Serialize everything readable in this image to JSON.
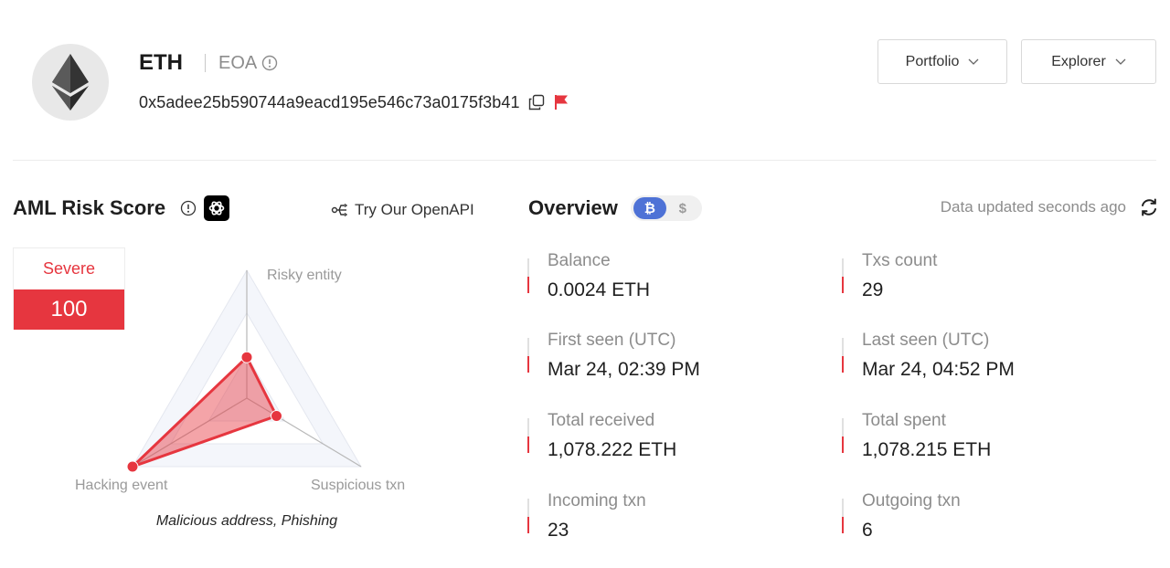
{
  "header": {
    "chain": "ETH",
    "account_type": "EOA",
    "address": "0x5adee25b590744a9eacd195e546c73a0175f3b41",
    "buttons": {
      "portfolio": "Portfolio",
      "explorer": "Explorer"
    }
  },
  "aml": {
    "title": "AML Risk Score",
    "openapi_link": "Try Our OpenAPI",
    "risk_level": "Severe",
    "risk_score": "100",
    "tags": "Malicious address, Phishing",
    "colors": {
      "risk": "#e6363f"
    }
  },
  "chart_data": {
    "type": "radar",
    "axes": [
      "Risky entity",
      "Suspicious txn",
      "Hacking event"
    ],
    "values": [
      0.32,
      0.26,
      1.0
    ],
    "range": [
      0,
      1
    ],
    "rings": 3
  },
  "overview": {
    "title": "Overview",
    "currency_toggle": {
      "active": "₿",
      "inactive": "$"
    },
    "updated": "Data updated seconds ago",
    "stats": [
      {
        "label": "Balance",
        "value": "0.0024 ETH"
      },
      {
        "label": "Txs count",
        "value": "29"
      },
      {
        "label": "First seen (UTC)",
        "value": "Mar 24, 02:39 PM"
      },
      {
        "label": "Last seen (UTC)",
        "value": "Mar 24, 04:52 PM"
      },
      {
        "label": "Total received",
        "value": "1,078.222 ETH"
      },
      {
        "label": "Total spent",
        "value": "1,078.215 ETH"
      },
      {
        "label": "Incoming txn",
        "value": "23"
      },
      {
        "label": "Outgoing txn",
        "value": "6"
      }
    ]
  }
}
